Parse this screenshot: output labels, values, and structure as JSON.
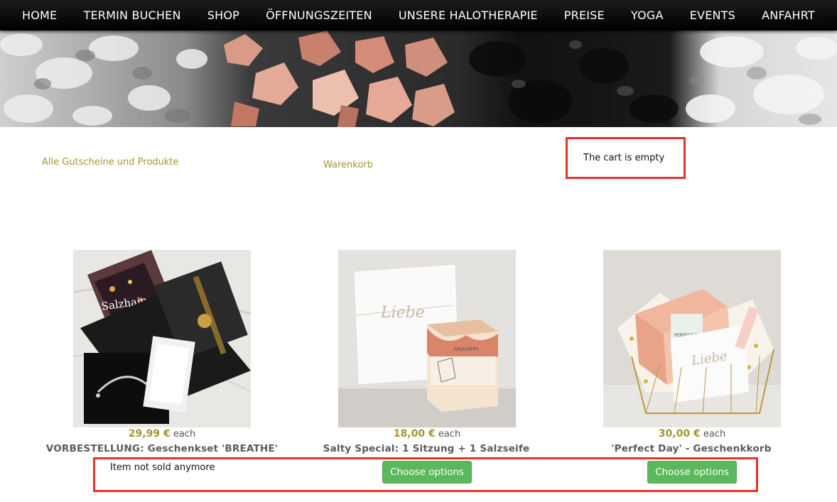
{
  "nav": {
    "items": [
      "HOME",
      "TERMIN BUCHEN",
      "SHOP",
      "ÖFFNUNGSZEITEN",
      "UNSERE HALOTHERAPIE",
      "PREISE",
      "YOGA",
      "EVENTS",
      "ANFAHRT"
    ]
  },
  "links": {
    "all_products": "Alle Gutscheine und Produkte",
    "cart": "Warenkorb",
    "cart_status": "The cart is empty"
  },
  "products": [
    {
      "price": "29,99 €",
      "price_unit": "each",
      "title": "VORBESTELLUNG: Geschenkset 'BREATHE'",
      "action": "Item not sold anymore"
    },
    {
      "price": "18,00 €",
      "price_unit": "each",
      "title": "Salty Special: 1 Sitzung + 1 Salzseife",
      "action": "Choose options"
    },
    {
      "price": "30,00 €",
      "price_unit": "each",
      "title": "'Perfect Day' - Geschenkkorb",
      "action": "Choose options"
    }
  ],
  "product_images": {
    "p1_text": "Salzhain",
    "p2_card_text": "Liebe",
    "p2_soap_label": "AM/HAPPY",
    "p3_box_text": "PERFECT DAY",
    "p3_card_text": "Liebe"
  },
  "colors": {
    "accent": "#a8922f",
    "button": "#5cb85c",
    "highlight": "#e8312a",
    "nav_bg": "#000000"
  }
}
